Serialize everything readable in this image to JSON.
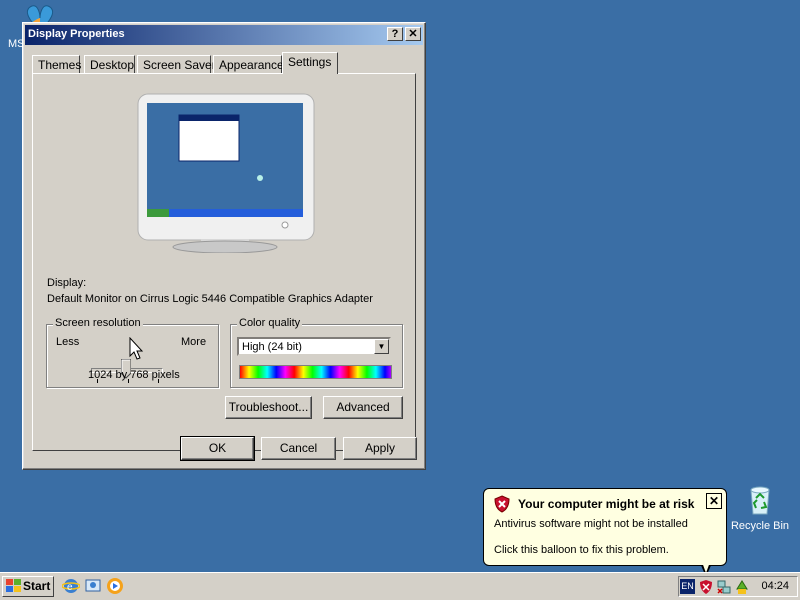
{
  "desktop": {
    "msn_label": "MS",
    "recycle_label": "Recycle Bin"
  },
  "dialog": {
    "title": "Display Properties",
    "help_glyph": "?",
    "close_glyph": "✕",
    "tabs": [
      {
        "label": "Themes"
      },
      {
        "label": "Desktop"
      },
      {
        "label": "Screen Saver"
      },
      {
        "label": "Appearance"
      },
      {
        "label": "Settings",
        "active": true
      }
    ],
    "display_label": "Display:",
    "display_value": "Default Monitor on Cirrus Logic 5446 Compatible Graphics Adapter",
    "resolution": {
      "group_title": "Screen resolution",
      "less": "Less",
      "more": "More",
      "value_text": "1024 by 768 pixels",
      "slider_level": 0.5
    },
    "color_quality": {
      "group_title": "Color quality",
      "selected": "High (24 bit)"
    },
    "buttons": {
      "troubleshoot": "Troubleshoot...",
      "advanced": "Advanced",
      "ok": "OK",
      "cancel": "Cancel",
      "apply": "Apply"
    }
  },
  "balloon": {
    "title": "Your computer might be at risk",
    "line1": "Antivirus software might not be installed",
    "line2": "Click this balloon to fix this problem.",
    "close_glyph": "✕"
  },
  "taskbar": {
    "start_label": "Start",
    "language": "EN",
    "clock": "04:24"
  }
}
